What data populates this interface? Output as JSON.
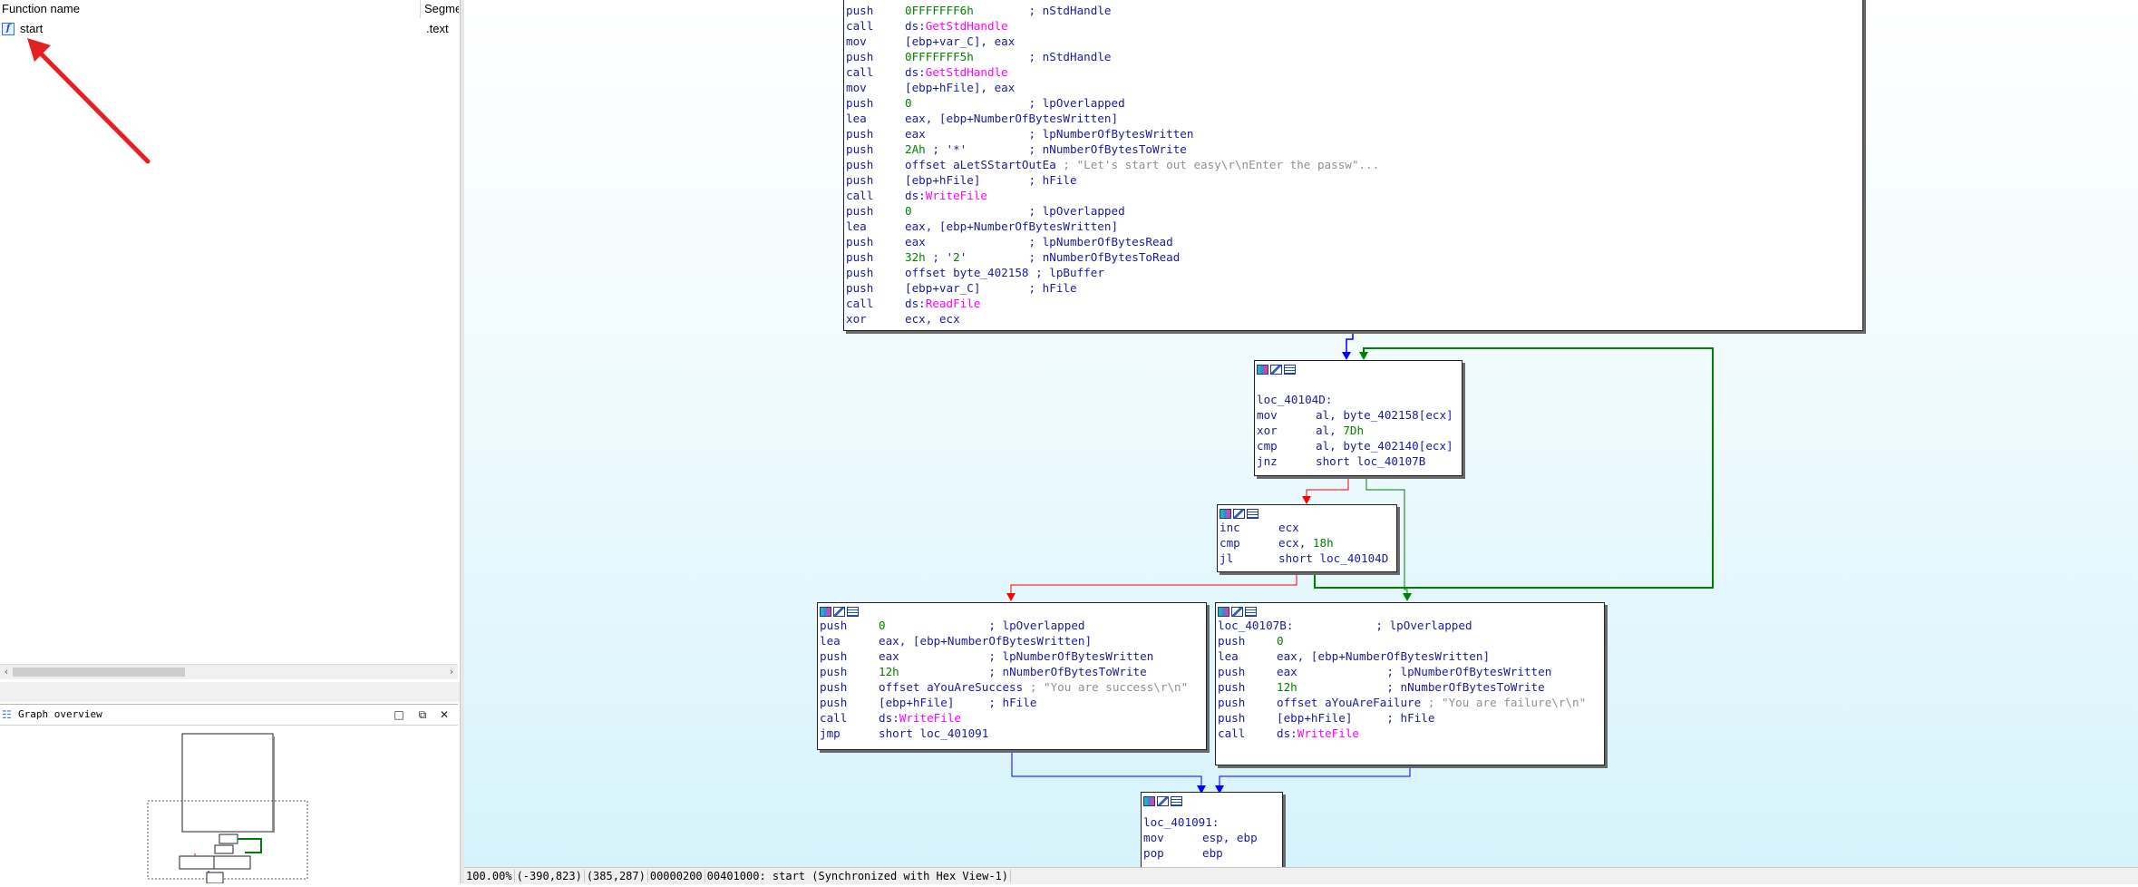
{
  "functions_panel": {
    "header": {
      "function_name": "Function name",
      "segment": "Segme"
    },
    "rows": [
      {
        "icon": "function-icon",
        "name": "start",
        "segment": ".text"
      }
    ]
  },
  "graph_overview": {
    "title": "Graph overview",
    "icon": "graph-icon",
    "buttons": {
      "minimize": "minimize-icon",
      "float": "float-icon",
      "close": "close-icon"
    }
  },
  "graph": {
    "block1": [
      {
        "mn": "push",
        "op": "0FFFFFFF6h",
        "cm": "; nStdHandle"
      },
      {
        "mn": "call",
        "op": "ds:",
        "imp": "GetStdHandle"
      },
      {
        "mn": "mov",
        "op": "[ebp+var_C], eax"
      },
      {
        "mn": "push",
        "op": "0FFFFFFF5h",
        "cm": "; nStdHandle"
      },
      {
        "mn": "call",
        "op": "ds:",
        "imp": "GetStdHandle"
      },
      {
        "mn": "mov",
        "op": "[ebp+hFile], eax"
      },
      {
        "mn": "push",
        "op": "0",
        "cm": "; lpOverlapped"
      },
      {
        "mn": "lea",
        "op": "eax, [ebp+NumberOfBytesWritten]"
      },
      {
        "mn": "push",
        "op": "eax",
        "cm": "; lpNumberOfBytesWritten"
      },
      {
        "mn": "push",
        "op": "2Ah ; '*'",
        "cm": "; nNumberOfBytesToWrite"
      },
      {
        "mn": "push",
        "op": "offset aLetSStartOutEa",
        "cm": "; \"Let's start out easy\\r\\nEnter the passw\"..."
      },
      {
        "mn": "push",
        "op": "[ebp+hFile]",
        "cm": "; hFile"
      },
      {
        "mn": "call",
        "op": "ds:",
        "imp": "WriteFile"
      },
      {
        "mn": "push",
        "op": "0",
        "cm": "; lpOverlapped"
      },
      {
        "mn": "lea",
        "op": "eax, [ebp+NumberOfBytesWritten]"
      },
      {
        "mn": "push",
        "op": "eax",
        "cm": "; lpNumberOfBytesRead"
      },
      {
        "mn": "push",
        "op": "32h ; '2'",
        "cm": "; nNumberOfBytesToRead"
      },
      {
        "mn": "push",
        "op": "offset byte_402158",
        "cm": "; lpBuffer"
      },
      {
        "mn": "push",
        "op": "[ebp+var_C]",
        "cm": "; hFile"
      },
      {
        "mn": "call",
        "op": "ds:",
        "imp": "ReadFile"
      },
      {
        "mn": "xor",
        "op": "ecx, ecx"
      }
    ],
    "block2": [
      {
        "lbl": "loc_40104D:"
      },
      {
        "mn": "mov",
        "op": "al, byte_402158[ecx]"
      },
      {
        "mn": "xor",
        "op": "al, 7Dh"
      },
      {
        "mn": "cmp",
        "op": "al, byte_402140[ecx]"
      },
      {
        "mn": "jnz",
        "op": "short loc_40107B"
      }
    ],
    "block3": [
      {
        "mn": "inc",
        "op": "ecx"
      },
      {
        "mn": "cmp",
        "op": "ecx, 18h"
      },
      {
        "mn": "jl",
        "op": "short loc_40104D"
      }
    ],
    "block4": [
      {
        "mn": "push",
        "op": "0",
        "cm": "; lpOverlapped"
      },
      {
        "mn": "lea",
        "op": "eax, [ebp+NumberOfBytesWritten]"
      },
      {
        "mn": "push",
        "op": "eax",
        "cm": "; lpNumberOfBytesWritten"
      },
      {
        "mn": "push",
        "op": "12h",
        "cm": "; nNumberOfBytesToWrite"
      },
      {
        "mn": "push",
        "op": "offset aYouAreSuccess",
        "cm": "; \"You are success\\r\\n\""
      },
      {
        "mn": "push",
        "op": "[ebp+hFile]",
        "cm": "; hFile"
      },
      {
        "mn": "call",
        "op": "ds:",
        "imp": "WriteFile"
      },
      {
        "mn": "jmp",
        "op": "short loc_401091"
      }
    ],
    "block5": [
      {
        "lbl": "loc_40107B:",
        "cm": "; lpOverlapped"
      },
      {
        "mn": "push",
        "op": "0"
      },
      {
        "mn": "lea",
        "op": "eax, [ebp+NumberOfBytesWritten]"
      },
      {
        "mn": "push",
        "op": "eax",
        "cm": "; lpNumberOfBytesWritten"
      },
      {
        "mn": "push",
        "op": "12h",
        "cm": "; nNumberOfBytesToWrite"
      },
      {
        "mn": "push",
        "op": "offset aYouAreFailure",
        "cm": "; \"You are failure\\r\\n\""
      },
      {
        "mn": "push",
        "op": "[ebp+hFile]",
        "cm": "; hFile"
      },
      {
        "mn": "call",
        "op": "ds:",
        "imp": "WriteFile"
      }
    ],
    "block6": [
      {
        "lbl": "loc_401091:"
      },
      {
        "mn": "mov",
        "op": "esp, ebp"
      },
      {
        "mn": "pop",
        "op": "ebp"
      }
    ]
  },
  "status_bar": {
    "zoom": "100.00%",
    "cursor": "(-390,823)",
    "graph_pos": "(385,287)",
    "offset": "00000200",
    "address_info": "00401000: start (Synchronized with Hex View-1)"
  },
  "colors": {
    "edge_true": "#008000",
    "edge_false": "#ff0000",
    "edge_uncond": "#0000ff",
    "imported_name": "#ff00ff",
    "number": "#008000",
    "mnemonic": "#1a1a9c"
  }
}
